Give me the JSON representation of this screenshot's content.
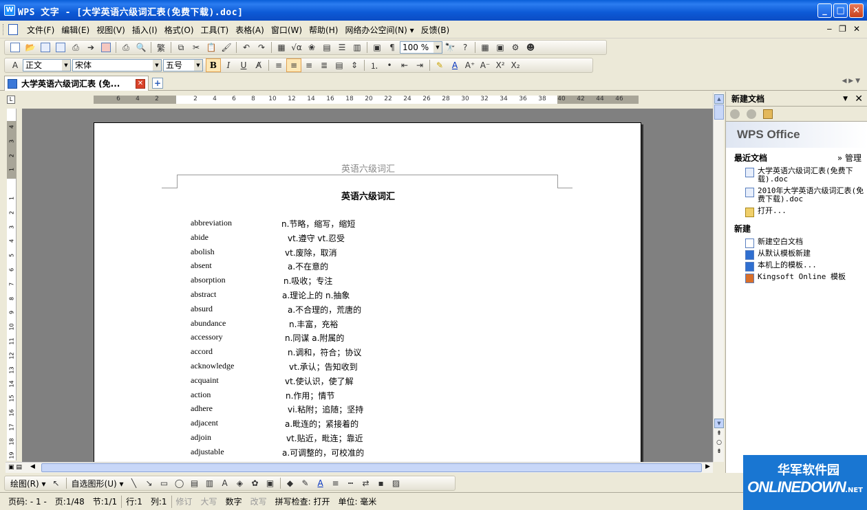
{
  "window": {
    "title": "WPS 文字 - [大学英语六级词汇表(免费下载).doc]",
    "app_icon": "W"
  },
  "menu": {
    "items": [
      "文件(F)",
      "编辑(E)",
      "视图(V)",
      "插入(I)",
      "格式(O)",
      "工具(T)",
      "表格(A)",
      "窗口(W)",
      "帮助(H)",
      "网络办公空间(N) ▾",
      "反馈(B)"
    ]
  },
  "format": {
    "style": "正文",
    "font": "宋体",
    "size": "五号",
    "zoom": "100 %"
  },
  "tab": {
    "label": "大学英语六级词汇表 (免..."
  },
  "ruler": {
    "ticks": [
      "6",
      "4",
      "2",
      "",
      "2",
      "4",
      "6",
      "8",
      "10",
      "12",
      "14",
      "16",
      "18",
      "20",
      "22",
      "24",
      "26",
      "28",
      "30",
      "32",
      "34",
      "36",
      "38",
      "40",
      "42",
      "44",
      "46"
    ],
    "vticks": [
      "4",
      "3",
      "2",
      "1",
      "",
      "1",
      "2",
      "3",
      "4",
      "5",
      "6",
      "7",
      "8",
      "9",
      "10",
      "11",
      "12",
      "13",
      "14",
      "15",
      "16",
      "17",
      "18",
      "19"
    ]
  },
  "document": {
    "header": "英语六级词汇",
    "title": "英语六级词汇",
    "entries": [
      {
        "word": "abbreviation",
        "def": "n.节略，缩写，缩短"
      },
      {
        "word": "abide",
        "def": "vt.遵守  vt.忍受"
      },
      {
        "word": "abolish",
        "def": "vt.废除，取消"
      },
      {
        "word": "absent",
        "def": "a.不在意的"
      },
      {
        "word": "absorption",
        "def": "n.吸收；专注"
      },
      {
        "word": "abstract",
        "def": "a.理论上的  n.抽象"
      },
      {
        "word": "absurd",
        "def": "a.不合理的，荒唐的"
      },
      {
        "word": "abundance",
        "def": "n.丰富，充裕"
      },
      {
        "word": "accessory",
        "def": "n.同谋  a.附属的"
      },
      {
        "word": "accord",
        "def": "n.调和，符合；协议"
      },
      {
        "word": "acknowledge",
        "def": "vt.承认；告知收到"
      },
      {
        "word": "acquaint",
        "def": "vt.使认识，使了解"
      },
      {
        "word": "action",
        "def": "n.作用；情节"
      },
      {
        "word": "adhere",
        "def": "vi.粘附；追随；坚持"
      },
      {
        "word": "adjacent",
        "def": "a.毗连的；紧接着的"
      },
      {
        "word": "adjoin",
        "def": "vt.贴近，毗连；靠近"
      },
      {
        "word": "adjustable",
        "def": "a.可调整的，可校准的"
      }
    ]
  },
  "taskpane": {
    "title": "新建文档",
    "logo": "WPS Office",
    "recent_label": "最近文档",
    "manage_label": "» 管理",
    "recent": [
      "大学英语六级词汇表(免费下载).doc",
      "2010年大学英语六级词汇表(免费下载).doc"
    ],
    "open_label": "打开...",
    "new_label": "新建",
    "new_items": [
      "新建空白文档",
      "从默认模板新建",
      "本机上的模板...",
      "Kingsoft Online 模板"
    ]
  },
  "drawbar": {
    "draw_label": "绘图(R) ▾",
    "autoshape_label": "自选图形(U) ▾"
  },
  "status": {
    "page_code": "页码: - 1 -",
    "page": "页:1/48",
    "section": "节:1/1",
    "row": "行:1",
    "col": "列:1",
    "revise": "修订",
    "caps": "大写",
    "num": "数字",
    "overwrite": "改写",
    "spell": "拼写检查: 打开",
    "unit": "单位: 毫米"
  },
  "watermark": {
    "cn": "华军软件园",
    "en": "ONLINEDOWN",
    "net": ".NET"
  },
  "colors": {
    "titlebar": "#0a5fd8",
    "accent_active": "#fde7b5"
  }
}
